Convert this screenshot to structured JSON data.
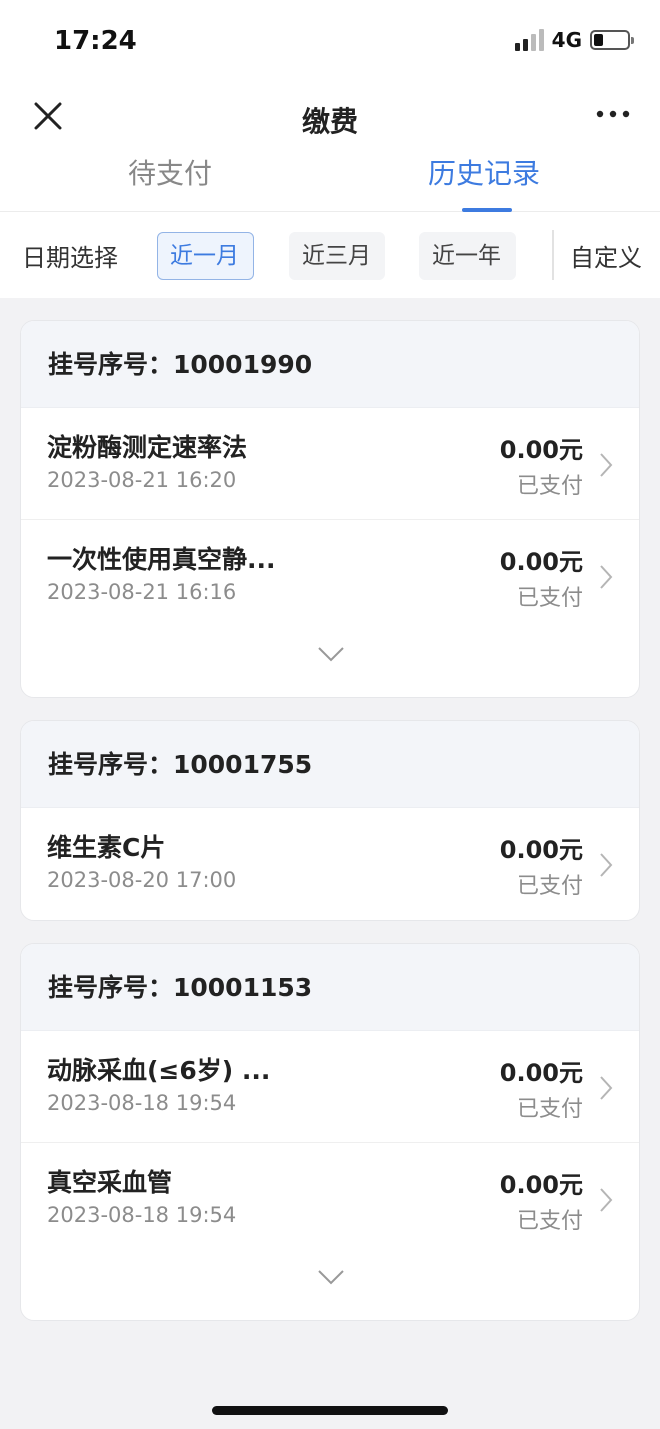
{
  "status_bar": {
    "time": "17:24",
    "network": "4G"
  },
  "nav": {
    "title": "缴费",
    "close_icon": "close-icon",
    "more_icon": "more-dots-icon"
  },
  "tabs": [
    {
      "label": "待支付",
      "active": false
    },
    {
      "label": "历史记录",
      "active": true
    }
  ],
  "filter": {
    "label": "日期选择",
    "options": [
      "近一月",
      "近三月",
      "近一年"
    ],
    "selected": "近一月",
    "custom_label": "自定义"
  },
  "colors": {
    "accent": "#3d7be0",
    "background": "#f2f2f4",
    "muted_text": "#8c8c8c"
  },
  "cards": [
    {
      "header": "挂号序号：10001990",
      "items": [
        {
          "name": "淀粉酶测定速率法",
          "time": "2023-08-21 16:20",
          "amount": "0.00元",
          "status": "已支付"
        },
        {
          "name": "一次性使用真空静...",
          "time": "2023-08-21 16:16",
          "amount": "0.00元",
          "status": "已支付"
        }
      ],
      "expandable": true
    },
    {
      "header": "挂号序号：10001755",
      "items": [
        {
          "name": "维生素C片",
          "time": "2023-08-20 17:00",
          "amount": "0.00元",
          "status": "已支付"
        }
      ],
      "expandable": false
    },
    {
      "header": "挂号序号：10001153",
      "items": [
        {
          "name": "动脉采血(≤6岁) ...",
          "time": "2023-08-18 19:54",
          "amount": "0.00元",
          "status": "已支付"
        },
        {
          "name": "真空采血管",
          "time": "2023-08-18 19:54",
          "amount": "0.00元",
          "status": "已支付"
        }
      ],
      "expandable": true
    }
  ]
}
